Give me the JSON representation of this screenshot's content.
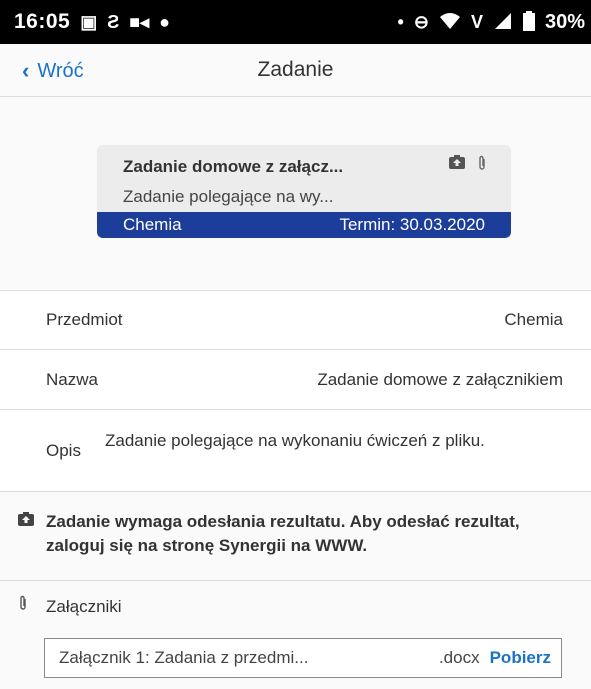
{
  "status_bar": {
    "time": "16:05",
    "left_icons": [
      "image-icon",
      "s-notification-icon",
      "video-call-icon",
      "dot-icon"
    ],
    "right_dot": "•",
    "network_label": "V",
    "battery": "30%"
  },
  "header": {
    "back_label": "Wróć",
    "title": "Zadanie"
  },
  "card": {
    "title": "Zadanie domowe z załącz...",
    "description": "Zadanie polegające na wy...",
    "subject": "Chemia",
    "deadline": "Termin: 30.03.2020",
    "accent_color": "#1c3d99"
  },
  "details": {
    "subject_label": "Przedmiot",
    "subject_value": "Chemia",
    "name_label": "Nazwa",
    "name_value": "Zadanie domowe z załącznikiem",
    "desc_label": "Opis",
    "desc_value": "Zadanie polegające na wykonaniu ćwiczeń z pliku."
  },
  "notice": {
    "text": "Zadanie wymaga odesłania rezultatu. Aby odesłać rezultat, zaloguj się na stronę Synergii na WWW."
  },
  "attachments": {
    "label": "Załączniki",
    "items": [
      {
        "name": "Załącznik 1: Zadania z przedmi...",
        "ext": ".docx",
        "action": "Pobierz"
      }
    ]
  }
}
